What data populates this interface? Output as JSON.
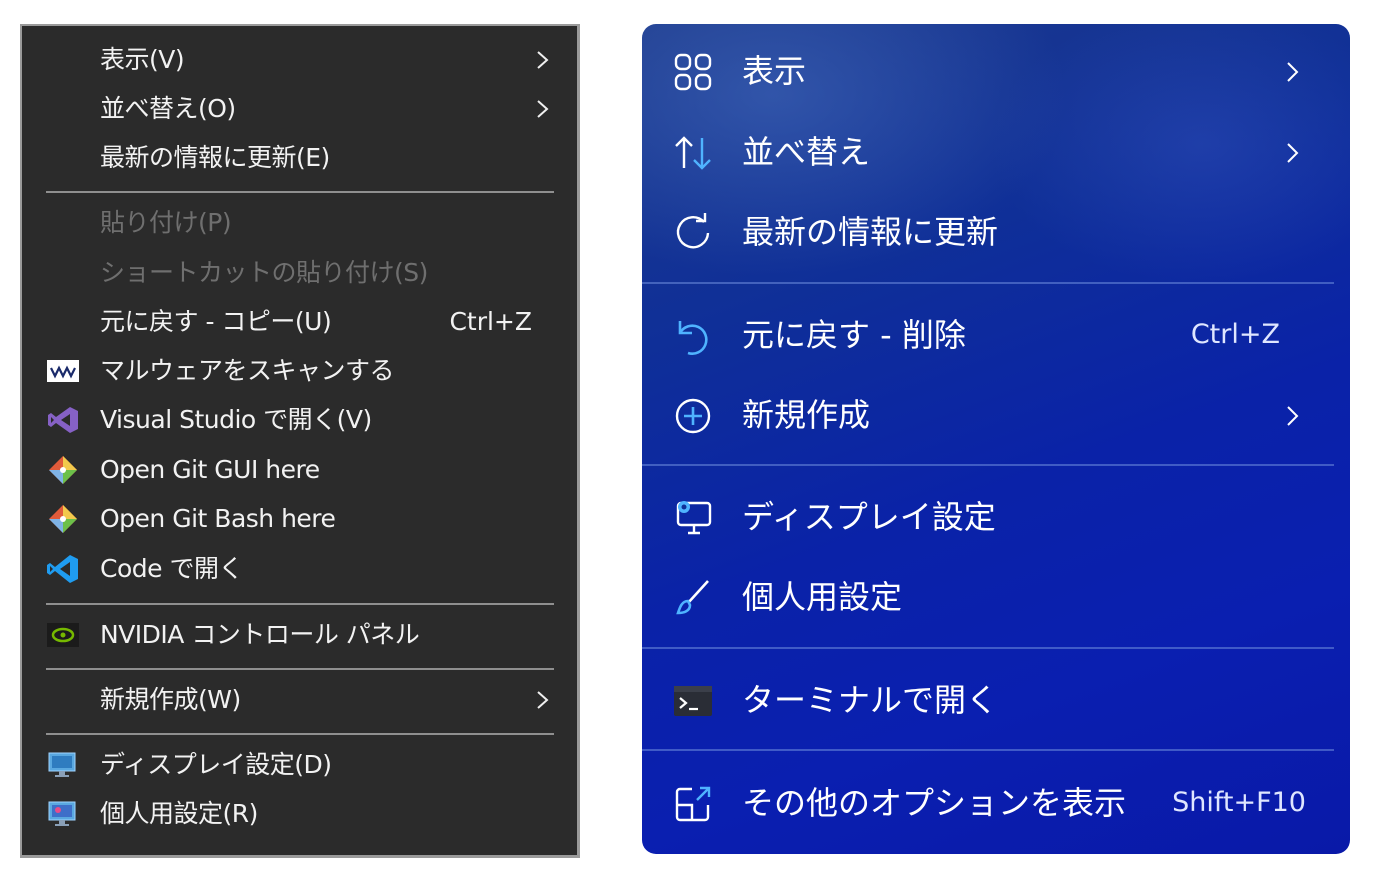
{
  "win10_menu": {
    "items": [
      {
        "label": "表示(V)"
      },
      {
        "label": "並べ替え(O)"
      },
      {
        "label": "最新の情報に更新(E)"
      },
      {
        "label": "貼り付け(P)"
      },
      {
        "label": "ショートカットの貼り付け(S)"
      },
      {
        "label": "元に戻す - コピー(U)",
        "shortcut": "Ctrl+Z"
      },
      {
        "label": "マルウェアをスキャンする",
        "icon": "malwarebytes-icon"
      },
      {
        "label": "Visual Studio で開く(V)",
        "icon": "visual-studio-icon"
      },
      {
        "label": "Open Git GUI here",
        "icon": "git-gui-icon"
      },
      {
        "label": "Open Git Bash here",
        "icon": "git-bash-icon"
      },
      {
        "label": "Code で開く",
        "icon": "vscode-icon"
      },
      {
        "label": "NVIDIA コントロール パネル",
        "icon": "nvidia-icon"
      },
      {
        "label": "新規作成(W)"
      },
      {
        "label": "ディスプレイ設定(D)",
        "icon": "display-settings-icon"
      },
      {
        "label": "個人用設定(R)",
        "icon": "personalize-icon"
      }
    ]
  },
  "win11_menu": {
    "items": [
      {
        "label": "表示",
        "icon": "view-grid-icon"
      },
      {
        "label": "並べ替え",
        "icon": "sort-icon"
      },
      {
        "label": "最新の情報に更新",
        "icon": "refresh-icon"
      },
      {
        "label": "元に戻す - 削除",
        "shortcut": "Ctrl+Z",
        "icon": "undo-icon"
      },
      {
        "label": "新規作成",
        "icon": "new-plus-icon"
      },
      {
        "label": "ディスプレイ設定",
        "icon": "display-settings-icon"
      },
      {
        "label": "個人用設定",
        "icon": "brush-icon"
      },
      {
        "label": "ターミナルで開く",
        "icon": "terminal-icon"
      },
      {
        "label": "その他のオプションを表示",
        "shortcut": "Shift+F10",
        "icon": "more-options-icon"
      }
    ]
  },
  "colors": {
    "win10_background": "#2b2b2b",
    "win10_disabled_text": "#6f6f6f",
    "win11_accent_icon": "#4fb3ff",
    "win11_background": "#0a22a8"
  }
}
